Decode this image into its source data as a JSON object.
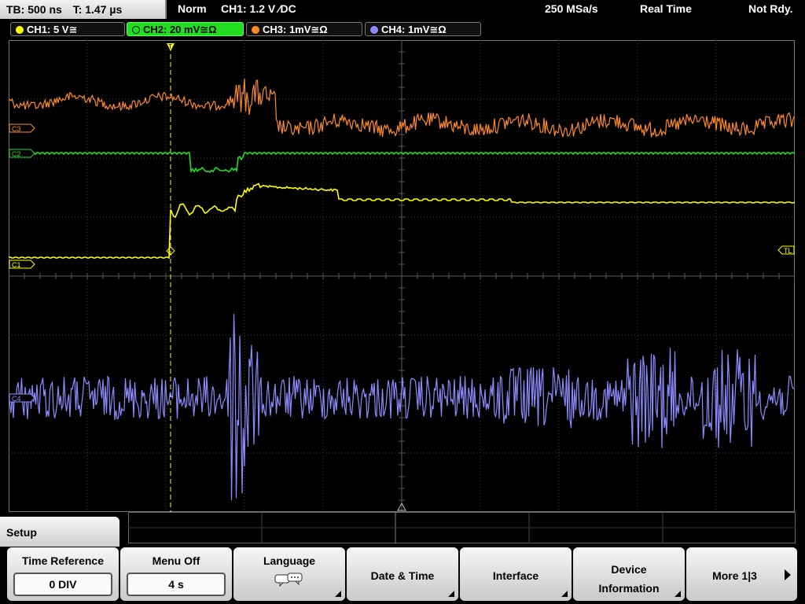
{
  "header": {
    "timebase": "TB: 500 ns",
    "trigger_time": "T: 1.47 µs",
    "mode": "Norm",
    "trigger_info": "CH1: 1.2 V ⁄DC",
    "sample_rate": "250 MSa/s",
    "acq_mode": "Real Time",
    "status": "Not Rdy."
  },
  "channels": [
    {
      "label": "CH1: 5 V≅",
      "color": "#ffff00"
    },
    {
      "label": "CH2: 20 mV≅Ω",
      "color": "#22dd22"
    },
    {
      "label": "CH3: 1mV≅Ω",
      "color": "#ff8a2a"
    },
    {
      "label": "CH4: 1mV≅Ω",
      "color": "#8c8cff"
    }
  ],
  "markers": {
    "c1": "C1",
    "c2": "C2",
    "c3": "C3",
    "c4": "C4",
    "tl": "TL",
    "trigger": "T"
  },
  "menu": {
    "title": "Setup",
    "softkeys": [
      {
        "title": "Time Reference",
        "value": "0 DIV"
      },
      {
        "title": "Menu Off",
        "value": "4 s"
      },
      {
        "title": "Language",
        "icon": "speech-bubbles-icon"
      },
      {
        "title": "Date & Time"
      },
      {
        "title": "Interface"
      },
      {
        "title": "Device Information"
      },
      {
        "title": "More 1|3"
      }
    ]
  },
  "colors": {
    "grid": "#3c3c3c",
    "ch1": "#ffff00",
    "ch2": "#22dd22",
    "ch3": "#ff8a2a",
    "ch4": "#8c8cff",
    "softkey_bg": "#e6e6e6"
  }
}
